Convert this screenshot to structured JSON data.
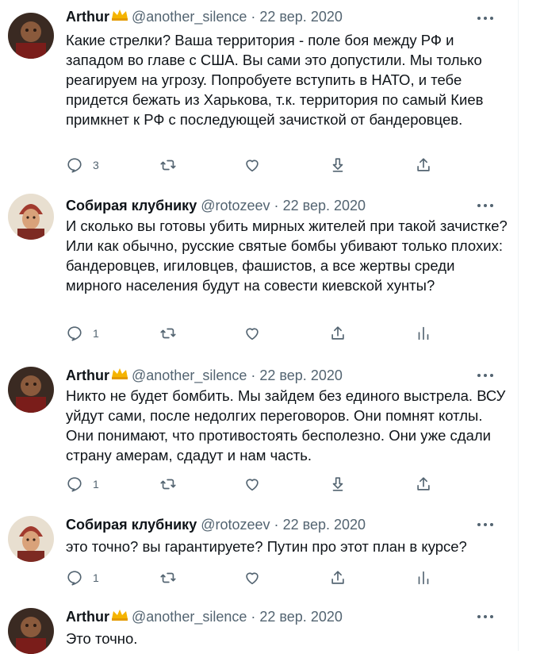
{
  "colors": {
    "text": "#0f1419",
    "muted": "#536471",
    "crown": "#f5b400"
  },
  "tweets": [
    {
      "author": "Arthur",
      "badge": "crown-emoji",
      "handle": "@another_silence",
      "dot": "·",
      "date": "22 вер. 2020",
      "text": "Какие стрелки? Ваша территория - поле боя между РФ и западом во главе с США. Вы сами это допустили. Мы только реагируем на угрозу. Попробуете вступить в НАТО, и тебе придется бежать из Харькова, т.к. территория по самый Киев примкнет к РФ с последующей зачисткой от бандеровцев.",
      "reply_count": "3",
      "actions": [
        "reply-icon",
        "retweet-icon",
        "like-icon",
        "download-icon",
        "share-icon"
      ]
    },
    {
      "author": "Собирая клубнику",
      "handle": "@rotozeev",
      "dot": "·",
      "date": "22 вер. 2020",
      "text": "И сколько вы готовы убить мирных жителей при такой зачистке? Или как обычно, русские святые бомбы убивают только плохих: бандеровцев, игиловцев, фашистов, а все жертвы среди мирного населения будут на совести киевской хунты?",
      "reply_count": "1",
      "actions": [
        "reply-icon",
        "retweet-icon",
        "like-icon",
        "share-icon",
        "analytics-icon"
      ]
    },
    {
      "author": "Arthur",
      "badge": "crown-emoji",
      "handle": "@another_silence",
      "dot": "·",
      "date": "22 вер. 2020",
      "text": "Никто не будет бомбить. Мы зайдем без единого выстрела. ВСУ уйдут сами, после недолгих переговоров. Они помнят котлы. Они понимают, что противостоять бесполезно. Они уже сдали страну амерам, сдадут и нам часть.",
      "reply_count": "1",
      "actions": [
        "reply-icon",
        "retweet-icon",
        "like-icon",
        "download-icon",
        "share-icon"
      ]
    },
    {
      "author": "Собирая клубнику",
      "handle": "@rotozeev",
      "dot": "·",
      "date": "22 вер. 2020",
      "text": "это точно? вы гарантируете? Путин про этот план в курсе?",
      "reply_count": "1",
      "actions": [
        "reply-icon",
        "retweet-icon",
        "like-icon",
        "share-icon",
        "analytics-icon"
      ]
    },
    {
      "author": "Arthur",
      "badge": "crown-emoji",
      "handle": "@another_silence",
      "dot": "·",
      "date": "22 вер. 2020",
      "text": "Это точно."
    }
  ]
}
